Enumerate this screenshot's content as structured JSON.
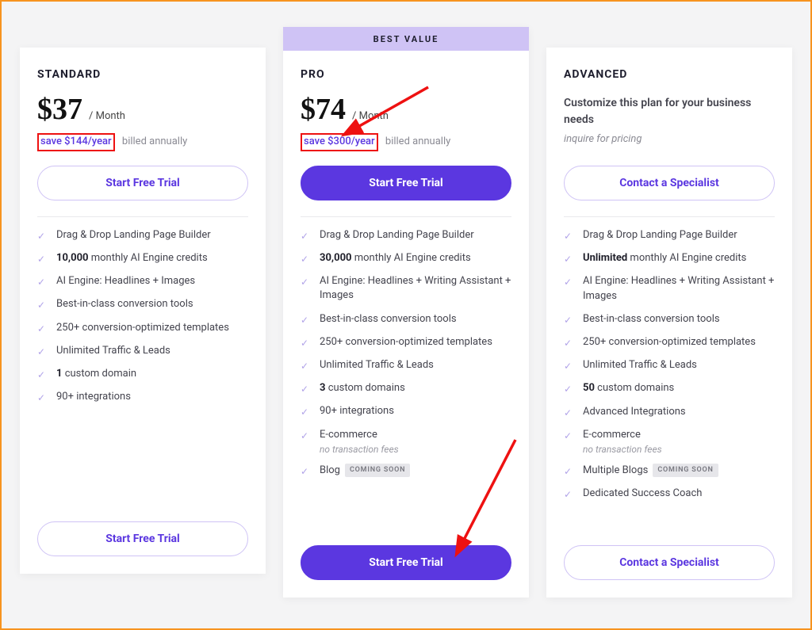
{
  "badge_best_value": "BEST VALUE",
  "coming_soon": "COMING SOON",
  "plans": {
    "standard": {
      "name": "STANDARD",
      "price": "$37",
      "per": "/ Month",
      "save": "save $144/year",
      "billed": "billed annually",
      "cta": "Start Free Trial",
      "features": [
        {
          "html": "Drag & Drop Landing Page Builder"
        },
        {
          "html": "<b>10,000</b> monthly AI Engine credits"
        },
        {
          "html": "AI Engine: Headlines + Images"
        },
        {
          "html": "Best-in-class conversion tools"
        },
        {
          "html": "250+ conversion-optimized templates"
        },
        {
          "html": "Unlimited Traffic & Leads"
        },
        {
          "html": "<b>1</b> custom domain"
        },
        {
          "html": "90+ integrations"
        }
      ]
    },
    "pro": {
      "name": "PRO",
      "price": "$74",
      "per": "/ Month",
      "save": "save $300/year",
      "billed": "billed annually",
      "cta": "Start Free Trial",
      "features": [
        {
          "html": "Drag & Drop Landing Page Builder"
        },
        {
          "html": "<b>30,000</b> monthly AI Engine credits"
        },
        {
          "html": "AI Engine: Headlines + Writing Assistant + Images"
        },
        {
          "html": "Best-in-class conversion tools"
        },
        {
          "html": "250+ conversion-optimized templates"
        },
        {
          "html": "Unlimited Traffic & Leads"
        },
        {
          "html": "<b>3</b> custom domains"
        },
        {
          "html": "90+ integrations"
        },
        {
          "html": "E-commerce",
          "sub": "no transaction fees"
        },
        {
          "html": "Blog",
          "badge": true
        }
      ]
    },
    "advanced": {
      "name": "ADVANCED",
      "customize": "Customize this plan for your business needs",
      "inquire": "inquire for pricing",
      "cta": "Contact a Specialist",
      "features": [
        {
          "html": "Drag & Drop Landing Page Builder"
        },
        {
          "html": "<b>Unlimited</b> monthly AI Engine credits"
        },
        {
          "html": "AI Engine: Headlines + Writing Assistant + Images"
        },
        {
          "html": "Best-in-class conversion tools"
        },
        {
          "html": "250+ conversion-optimized templates"
        },
        {
          "html": "Unlimited Traffic & Leads"
        },
        {
          "html": "<b>50</b> custom domains"
        },
        {
          "html": "Advanced Integrations"
        },
        {
          "html": "E-commerce",
          "sub": "no transaction fees"
        },
        {
          "html": "Multiple Blogs",
          "badge": true
        },
        {
          "html": "Dedicated Success Coach"
        }
      ]
    }
  }
}
